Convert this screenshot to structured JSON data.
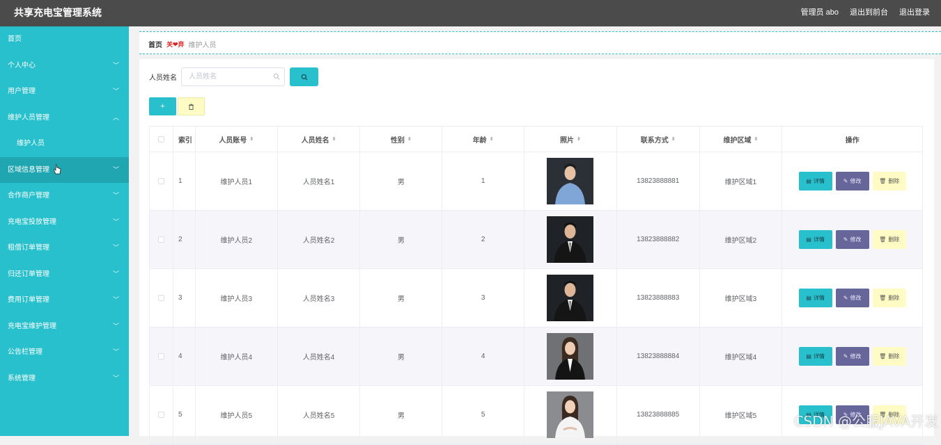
{
  "header": {
    "title": "共享充电宝管理系统",
    "user": "管理员 abo",
    "to_frontend": "退出到前台",
    "logout": "退出登录"
  },
  "sidebar": {
    "items": [
      {
        "label": "首页"
      },
      {
        "label": "个人中心"
      },
      {
        "label": "用户管理"
      },
      {
        "label": "维护人员管理"
      },
      {
        "label": "维护人员"
      },
      {
        "label": "区域信息管理"
      },
      {
        "label": "合作商户管理"
      },
      {
        "label": "充电宝投放管理"
      },
      {
        "label": "租借订单管理"
      },
      {
        "label": "归还订单管理"
      },
      {
        "label": "费用订单管理"
      },
      {
        "label": "充电宝维护管理"
      },
      {
        "label": "公告栏管理"
      },
      {
        "label": "系统管理"
      }
    ]
  },
  "breadcrumb": {
    "home": "首页",
    "separator": "关❤弃",
    "current": "维护人员"
  },
  "search": {
    "label": "人员姓名",
    "placeholder": "人员姓名"
  },
  "table": {
    "headers": [
      "索引",
      "人员账号",
      "人员姓名",
      "性别",
      "年龄",
      "照片",
      "联系方式",
      "维护区域",
      "操作"
    ],
    "rows": [
      {
        "index": "1",
        "account": "维护人员1",
        "name": "人员姓名1",
        "gender": "男",
        "age": "1",
        "phone": "13823888881",
        "area": "维护区域1"
      },
      {
        "index": "2",
        "account": "维护人员2",
        "name": "人员姓名2",
        "gender": "男",
        "age": "2",
        "phone": "13823888882",
        "area": "维护区域2"
      },
      {
        "index": "3",
        "account": "维护人员3",
        "name": "人员姓名3",
        "gender": "男",
        "age": "3",
        "phone": "13823888883",
        "area": "维护区域3"
      },
      {
        "index": "4",
        "account": "维护人员4",
        "name": "人员姓名4",
        "gender": "男",
        "age": "4",
        "phone": "13823888884",
        "area": "维护区域4"
      },
      {
        "index": "5",
        "account": "维护人员5",
        "name": "人员姓名5",
        "gender": "男",
        "age": "5",
        "phone": "13823888885",
        "area": "维护区域5"
      }
    ],
    "ops": {
      "detail": "详情",
      "edit": "修改",
      "delete": "删除"
    }
  },
  "watermark": "CSDN @公服JAVA开发",
  "colors": {
    "accent": "#27c0cc",
    "topbar": "#4b4b4b",
    "edit": "#66669a",
    "delete": "#fffbc4"
  }
}
